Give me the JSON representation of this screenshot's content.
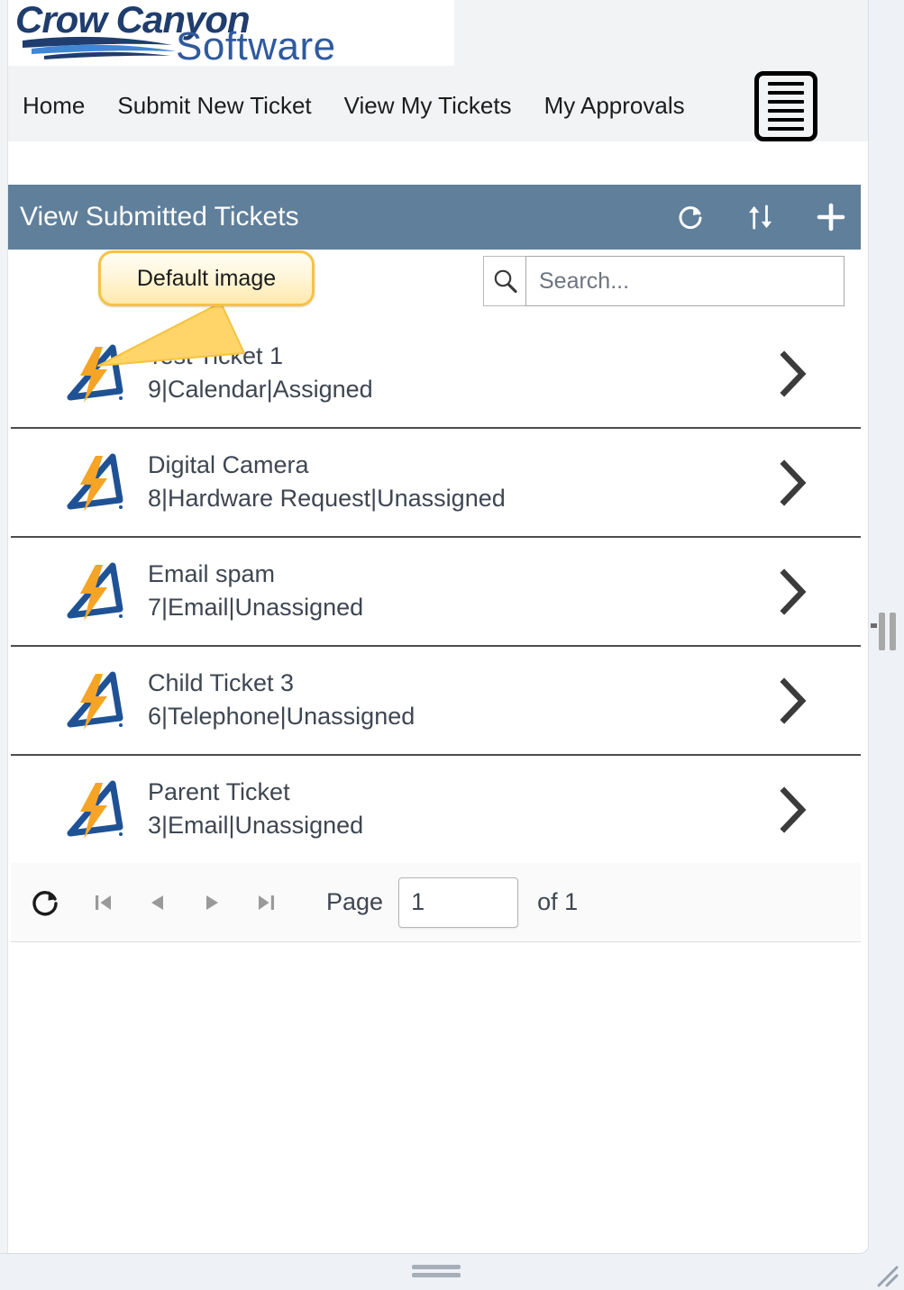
{
  "brand": {
    "name_line1": "Crow Canyon",
    "name_line2": "Software",
    "logo_color_dark": "#1f3d6e",
    "logo_color_mid": "#2f5a9e",
    "logo_color_light": "#3f87d6"
  },
  "nav": {
    "items": [
      {
        "label": "Home",
        "name": "nav-home"
      },
      {
        "label": "Submit New Ticket",
        "name": "nav-submit-new-ticket"
      },
      {
        "label": "View My Tickets",
        "name": "nav-view-my-tickets"
      },
      {
        "label": "My Approvals",
        "name": "nav-my-approvals"
      }
    ],
    "menu_icon": "hamburger-icon"
  },
  "view_header": {
    "title": "View Submitted Tickets",
    "background_color": "#5f7f9b",
    "actions": [
      {
        "name": "refresh-icon",
        "label": "Refresh"
      },
      {
        "name": "sort-icon",
        "label": "Sort"
      },
      {
        "name": "add-icon",
        "label": "Add"
      }
    ]
  },
  "search": {
    "placeholder": "Search...",
    "value": "",
    "icon": "search-icon"
  },
  "callout": {
    "text": "Default image"
  },
  "tickets": [
    {
      "title": "Test Ticket 1",
      "subtitle": "9|Calendar|Assigned",
      "id": "9",
      "category": "Calendar",
      "status": "Assigned",
      "icon": "crow-canyon-bolt-icon"
    },
    {
      "title": "Digital Camera",
      "subtitle": "8|Hardware Request|Unassigned",
      "id": "8",
      "category": "Hardware Request",
      "status": "Unassigned",
      "icon": "crow-canyon-bolt-icon"
    },
    {
      "title": "Email spam",
      "subtitle": "7|Email|Unassigned",
      "id": "7",
      "category": "Email",
      "status": "Unassigned",
      "icon": "crow-canyon-bolt-icon"
    },
    {
      "title": "Child Ticket 3",
      "subtitle": "6|Telephone|Unassigned",
      "id": "6",
      "category": "Telephone",
      "status": "Unassigned",
      "icon": "crow-canyon-bolt-icon"
    },
    {
      "title": "Parent Ticket",
      "subtitle": "3|Email|Unassigned",
      "id": "3",
      "category": "Email",
      "status": "Unassigned",
      "icon": "crow-canyon-bolt-icon"
    }
  ],
  "pager": {
    "page_label": "Page",
    "page_value": "1",
    "of_label": "of 1",
    "total_pages": "1",
    "buttons": [
      {
        "name": "pager-refresh-icon",
        "label": "Refresh"
      },
      {
        "name": "pager-first-icon",
        "label": "First page"
      },
      {
        "name": "pager-prev-icon",
        "label": "Previous page"
      },
      {
        "name": "pager-next-icon",
        "label": "Next page"
      },
      {
        "name": "pager-last-icon",
        "label": "Last page"
      }
    ]
  },
  "colors": {
    "header_blue": "#5f7f9b",
    "page_background": "#eef1f6",
    "nav_background": "#f2f3f5",
    "text": "#3e4652",
    "bolt_orange": "#f5a425",
    "triangle_blue": "#1f5295",
    "callout_border": "#f5c343"
  }
}
